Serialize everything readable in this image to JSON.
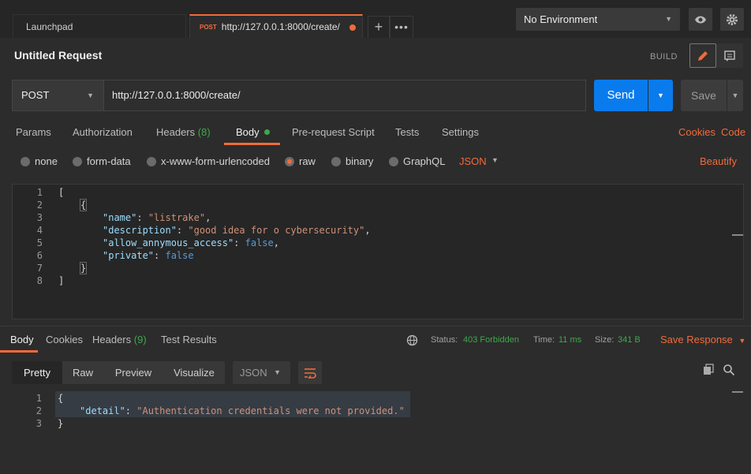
{
  "tabs": {
    "launchpad": "Launchpad",
    "request_method": "POST",
    "request_url": "http://127.0.0.1:8000/create/"
  },
  "environment": {
    "selected": "No Environment"
  },
  "request": {
    "title": "Untitled Request",
    "mode_label": "BUILD",
    "method": "POST",
    "url": "http://127.0.0.1:8000/create/",
    "send_label": "Send",
    "save_label": "Save"
  },
  "request_tabs": {
    "params": "Params",
    "authorization": "Authorization",
    "headers": "Headers",
    "headers_count": "(8)",
    "body": "Body",
    "pre_request": "Pre-request Script",
    "tests": "Tests",
    "settings": "Settings",
    "cookies": "Cookies",
    "code": "Code"
  },
  "body_types": {
    "none": "none",
    "form_data": "form-data",
    "urlencoded": "x-www-form-urlencoded",
    "raw": "raw",
    "binary": "binary",
    "graphql": "GraphQL",
    "format": "JSON",
    "beautify": "Beautify"
  },
  "editor": {
    "line_numbers": [
      "1",
      "2",
      "3",
      "4",
      "5",
      "6",
      "7",
      "8"
    ],
    "lines": {
      "l1": "[",
      "l2": "{",
      "name_key": "\"name\"",
      "name_val": "\"listrake\"",
      "desc_key": "\"description\"",
      "desc_val": "\"good idea for o cybersecurity\"",
      "anon_key": "\"allow_annymous_access\"",
      "anon_val": "false",
      "private_key": "\"private\"",
      "private_val": "false",
      "l7": "}",
      "l8": "]"
    }
  },
  "response": {
    "tabs": {
      "body": "Body",
      "cookies": "Cookies",
      "headers": "Headers",
      "headers_count": "(9)",
      "test_results": "Test Results"
    },
    "status_label": "Status:",
    "status_value": "403 Forbidden",
    "time_label": "Time:",
    "time_value": "11 ms",
    "size_label": "Size:",
    "size_value": "341 B",
    "save_response": "Save Response",
    "views": {
      "pretty": "Pretty",
      "raw": "Raw",
      "preview": "Preview",
      "visualize": "Visualize"
    },
    "format": "JSON",
    "line_numbers": [
      "1",
      "2",
      "3"
    ],
    "lines": {
      "l1": "{",
      "detail_key": "\"detail\"",
      "detail_val": "\"Authentication credentials were not provided.\"",
      "l3": "}"
    }
  },
  "colors": {
    "accent": "#f26b3a",
    "send": "#097bed",
    "success": "#3ea84a"
  }
}
